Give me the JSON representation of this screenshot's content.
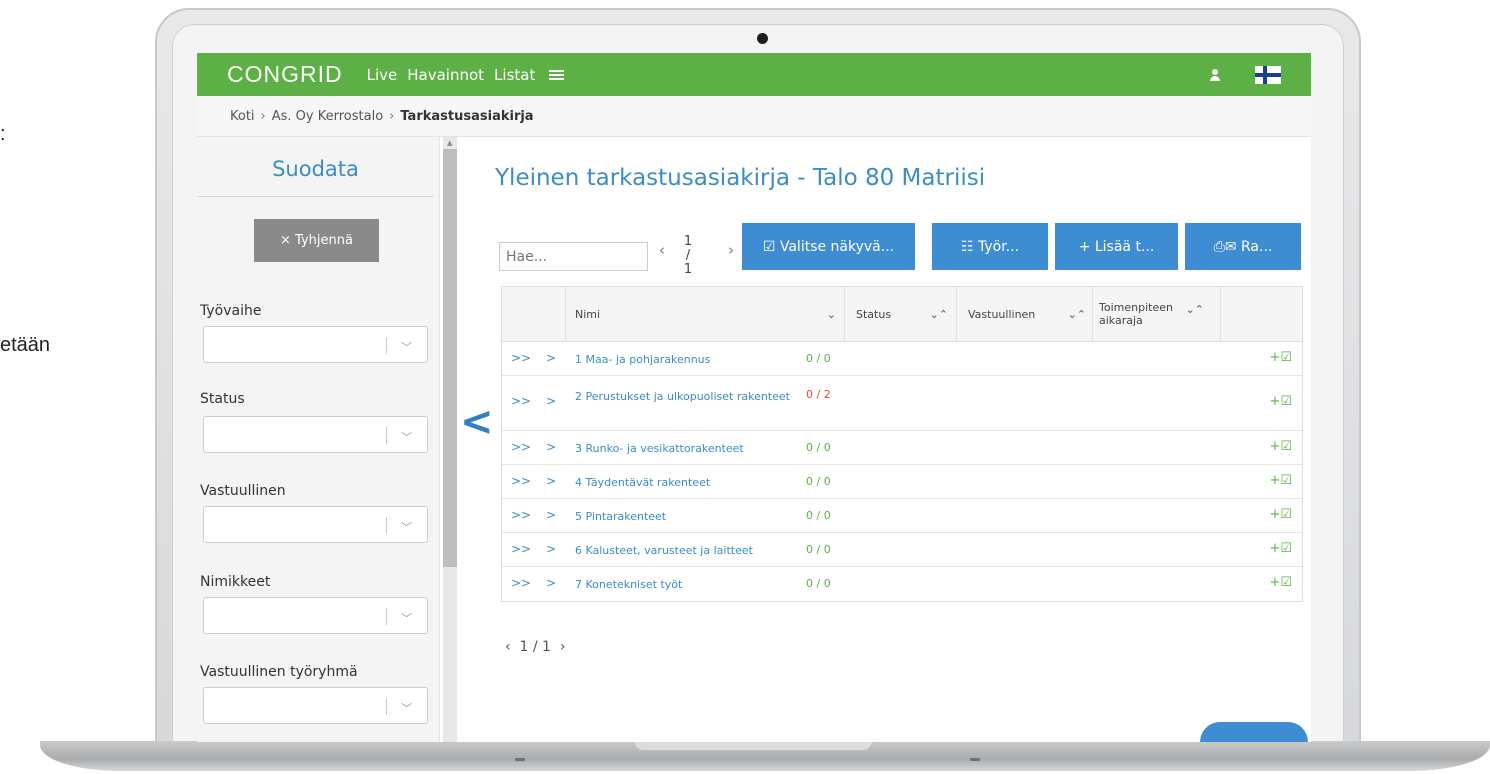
{
  "slide_fragments": {
    "line1": ":",
    "line2": "etään"
  },
  "topbar": {
    "logo": "CONGRID",
    "nav": [
      "Live",
      "Havainnot",
      "Listat"
    ],
    "menu_icon": "hamburger-icon",
    "user_icon": "user-icon",
    "language_flag": "finland-flag-icon",
    "color": "#5db046"
  },
  "breadcrumb": {
    "items": [
      "Koti",
      "As. Oy Kerrostalo"
    ],
    "current": "Tarkastusasiakirja"
  },
  "sidebar": {
    "title": "Suodata",
    "clear_button": "× Tyhjennä",
    "filters": [
      {
        "label": "Työvaihe"
      },
      {
        "label": "Status"
      },
      {
        "label": "Vastuullinen"
      },
      {
        "label": "Nimikkeet"
      },
      {
        "label": "Vastuullinen työryhmä"
      }
    ]
  },
  "main": {
    "title": "Yleinen tarkastusasiakirja - Talo 80 Matriisi",
    "search_placeholder": "Hae...",
    "pager_top": {
      "current": "1 /",
      "total": "1"
    },
    "buttons": [
      {
        "icon": "checkbox-icon",
        "label": "☑ Valitse näkyvä..."
      },
      {
        "icon": "list-icon",
        "label": "☷ Työr..."
      },
      {
        "icon": "plus-icon",
        "label": "+ Lisää t..."
      },
      {
        "icon": "print-mail-icon",
        "label": "⎙✉ Ra..."
      }
    ],
    "columns": {
      "name": "Nimi",
      "status": "Status",
      "responsible": "Vastuullinen",
      "deadline_line1": "Toimenpiteen",
      "deadline_line2": "aikaraja"
    },
    "rows": [
      {
        "name": "1 Maa- ja pohjarakennus",
        "count": "0 / 0",
        "count_color": "#5db046"
      },
      {
        "name": "2 Perustukset ja ulkopuoliset rakenteet",
        "count": "0 / 2",
        "count_color": "#e04a3a"
      },
      {
        "name": "3 Runko- ja vesikattorakenteet",
        "count": "0 / 0",
        "count_color": "#5db046"
      },
      {
        "name": "4 Täydentävät rakenteet",
        "count": "0 / 0",
        "count_color": "#5db046"
      },
      {
        "name": "5 Pintarakenteet",
        "count": "0 / 0",
        "count_color": "#5db046"
      },
      {
        "name": "6 Kalusteet, varusteet ja laitteet",
        "count": "0 / 0",
        "count_color": "#5db046"
      },
      {
        "name": "7 Konetekniset työt",
        "count": "0 / 0",
        "count_color": "#5db046"
      }
    ],
    "pager_bottom": "1 / 1"
  },
  "accent_color": "#3e8dd3"
}
